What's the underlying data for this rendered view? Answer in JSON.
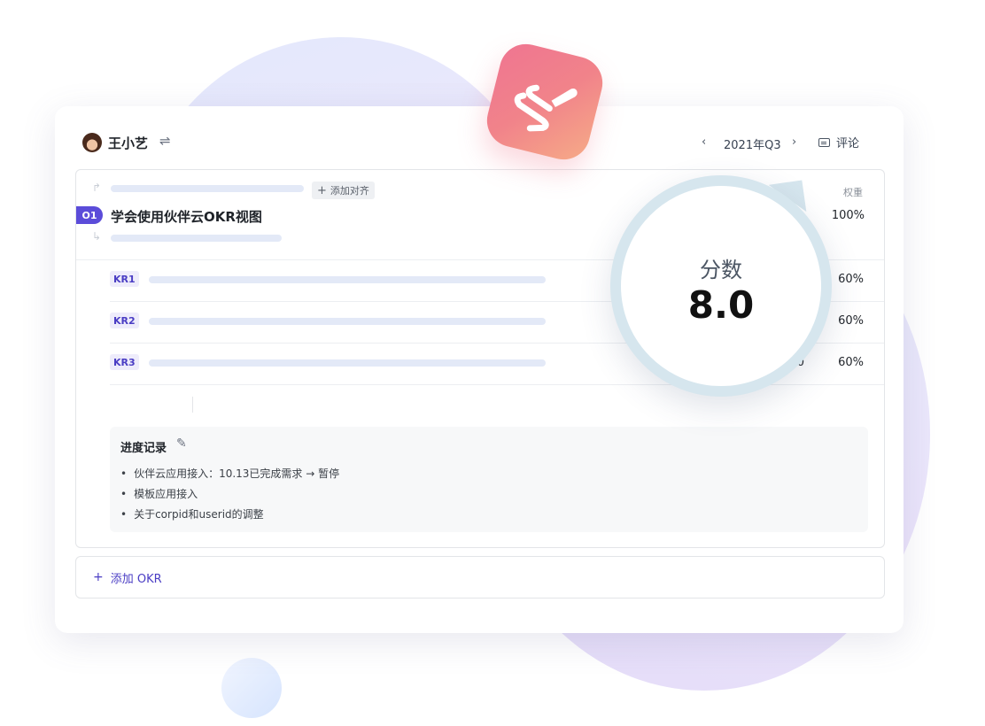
{
  "header": {
    "user_name": "王小艺",
    "quarter": "2021年Q3",
    "prev_icon": "‹",
    "next_icon": "›",
    "comment_label": "评论"
  },
  "objective": {
    "badge": "O1",
    "title": "学会使用伙伴云OKR视图",
    "add_align_label": "添加对齐",
    "weight_header": "权重",
    "weight": "100%"
  },
  "key_results": [
    {
      "badge": "KR1",
      "score": "",
      "weight": "60%"
    },
    {
      "badge": "KR2",
      "score": "",
      "weight": "60%"
    },
    {
      "badge": "KR3",
      "score": ".0",
      "weight": "60%"
    }
  ],
  "progress": {
    "title": "进度记录",
    "items": [
      "伙伴云应用接入：10.13已完成需求 → 暂停",
      "模板应用接入",
      "关于corpid和userid的调整"
    ]
  },
  "add_okr": {
    "label": "添加 OKR"
  },
  "magnifier": {
    "label": "分数",
    "value": "8.0"
  },
  "icons": {
    "avatar": "avatar",
    "swap": "swap-icon",
    "comment": "comment-icon",
    "edit": "edit-icon",
    "app": "app-logo-icon"
  },
  "colors": {
    "accent": "#5b4cd9",
    "kr_badge_bg": "#eeecfb",
    "app_icon_from": "#ef7591",
    "app_icon_to": "#f6ab87",
    "magnifier_ring": "#d6e6ee"
  }
}
